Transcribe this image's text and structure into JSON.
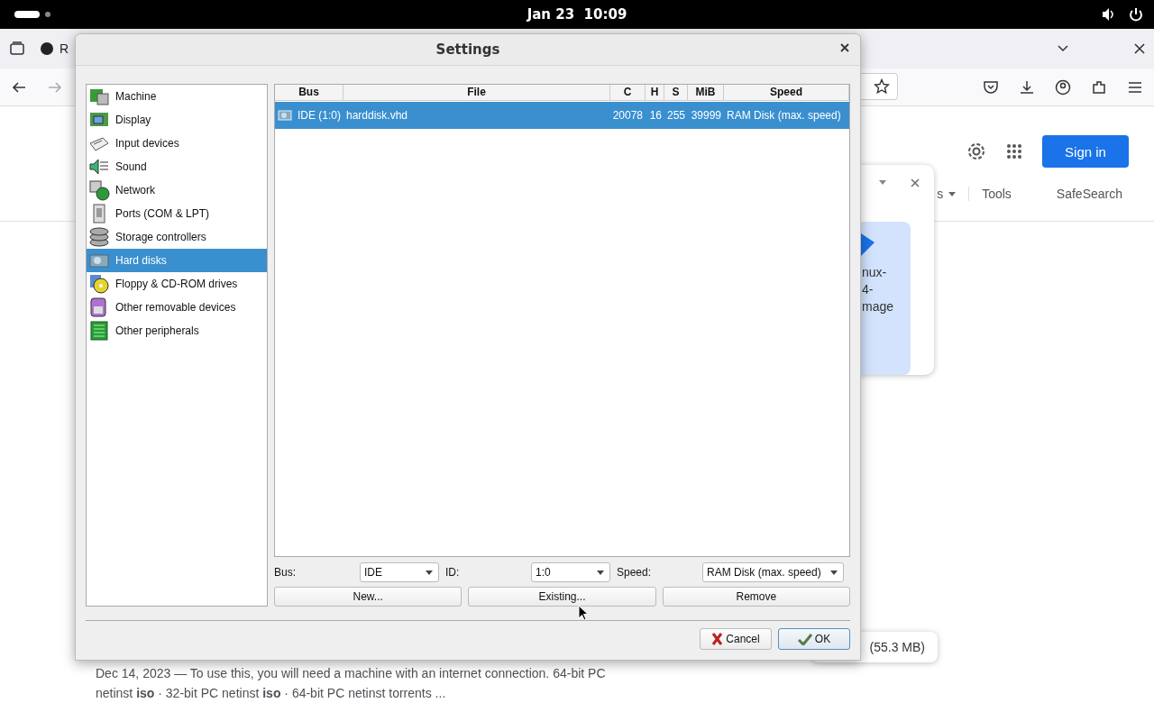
{
  "top_bar": {
    "clock": "Jan 23  10:09"
  },
  "browser": {
    "tab": {
      "title": "R"
    }
  },
  "page": {
    "sign_in": "Sign in",
    "filters": [
      {
        "label": "s",
        "kind": "menu"
      },
      {
        "label": "Tools",
        "kind": "link"
      },
      {
        "label": "SafeSearch",
        "kind": "link"
      }
    ],
    "preview_card": {
      "caption": [
        "nux-",
        "4-",
        "mage"
      ]
    },
    "download_card": {
      "size": "(55.3 MB)"
    },
    "snippet": [
      "Dec 14, 2023 — To use this, you will need a machine with an internet connection. 64-bit PC",
      "netinst **iso** · 32-bit PC netinst **iso** · 64-bit PC netinst torrents ..."
    ]
  },
  "dialog": {
    "title": "Settings",
    "categories": [
      {
        "label": "Machine",
        "selected": false
      },
      {
        "label": "Display",
        "selected": false
      },
      {
        "label": "Input devices",
        "selected": false
      },
      {
        "label": "Sound",
        "selected": false
      },
      {
        "label": "Network",
        "selected": false
      },
      {
        "label": "Ports (COM & LPT)",
        "selected": false
      },
      {
        "label": "Storage controllers",
        "selected": false
      },
      {
        "label": "Hard disks",
        "selected": true
      },
      {
        "label": "Floppy & CD-ROM drives",
        "selected": false
      },
      {
        "label": "Other removable devices",
        "selected": false
      },
      {
        "label": "Other peripherals",
        "selected": false
      }
    ],
    "table": {
      "columns": [
        "Bus",
        "File",
        "C",
        "H",
        "S",
        "MiB",
        "Speed"
      ],
      "rows": [
        {
          "cells": [
            "IDE (1:0)",
            "harddisk.vhd",
            "20078",
            "16",
            "255",
            "39999",
            "RAM Disk (max. speed)"
          ],
          "selected": true
        }
      ]
    },
    "fields": [
      {
        "label": "Bus:",
        "value": "IDE"
      },
      {
        "label": "ID:",
        "value": "1:0"
      },
      {
        "label": "Speed:",
        "value": "RAM Disk (max. speed)"
      }
    ],
    "buttons": [
      "New...",
      "Existing...",
      "Remove"
    ],
    "footer_buttons": [
      {
        "label": "Cancel",
        "kind": "cancel",
        "default": false
      },
      {
        "label": "OK",
        "kind": "ok",
        "default": true
      }
    ]
  }
}
